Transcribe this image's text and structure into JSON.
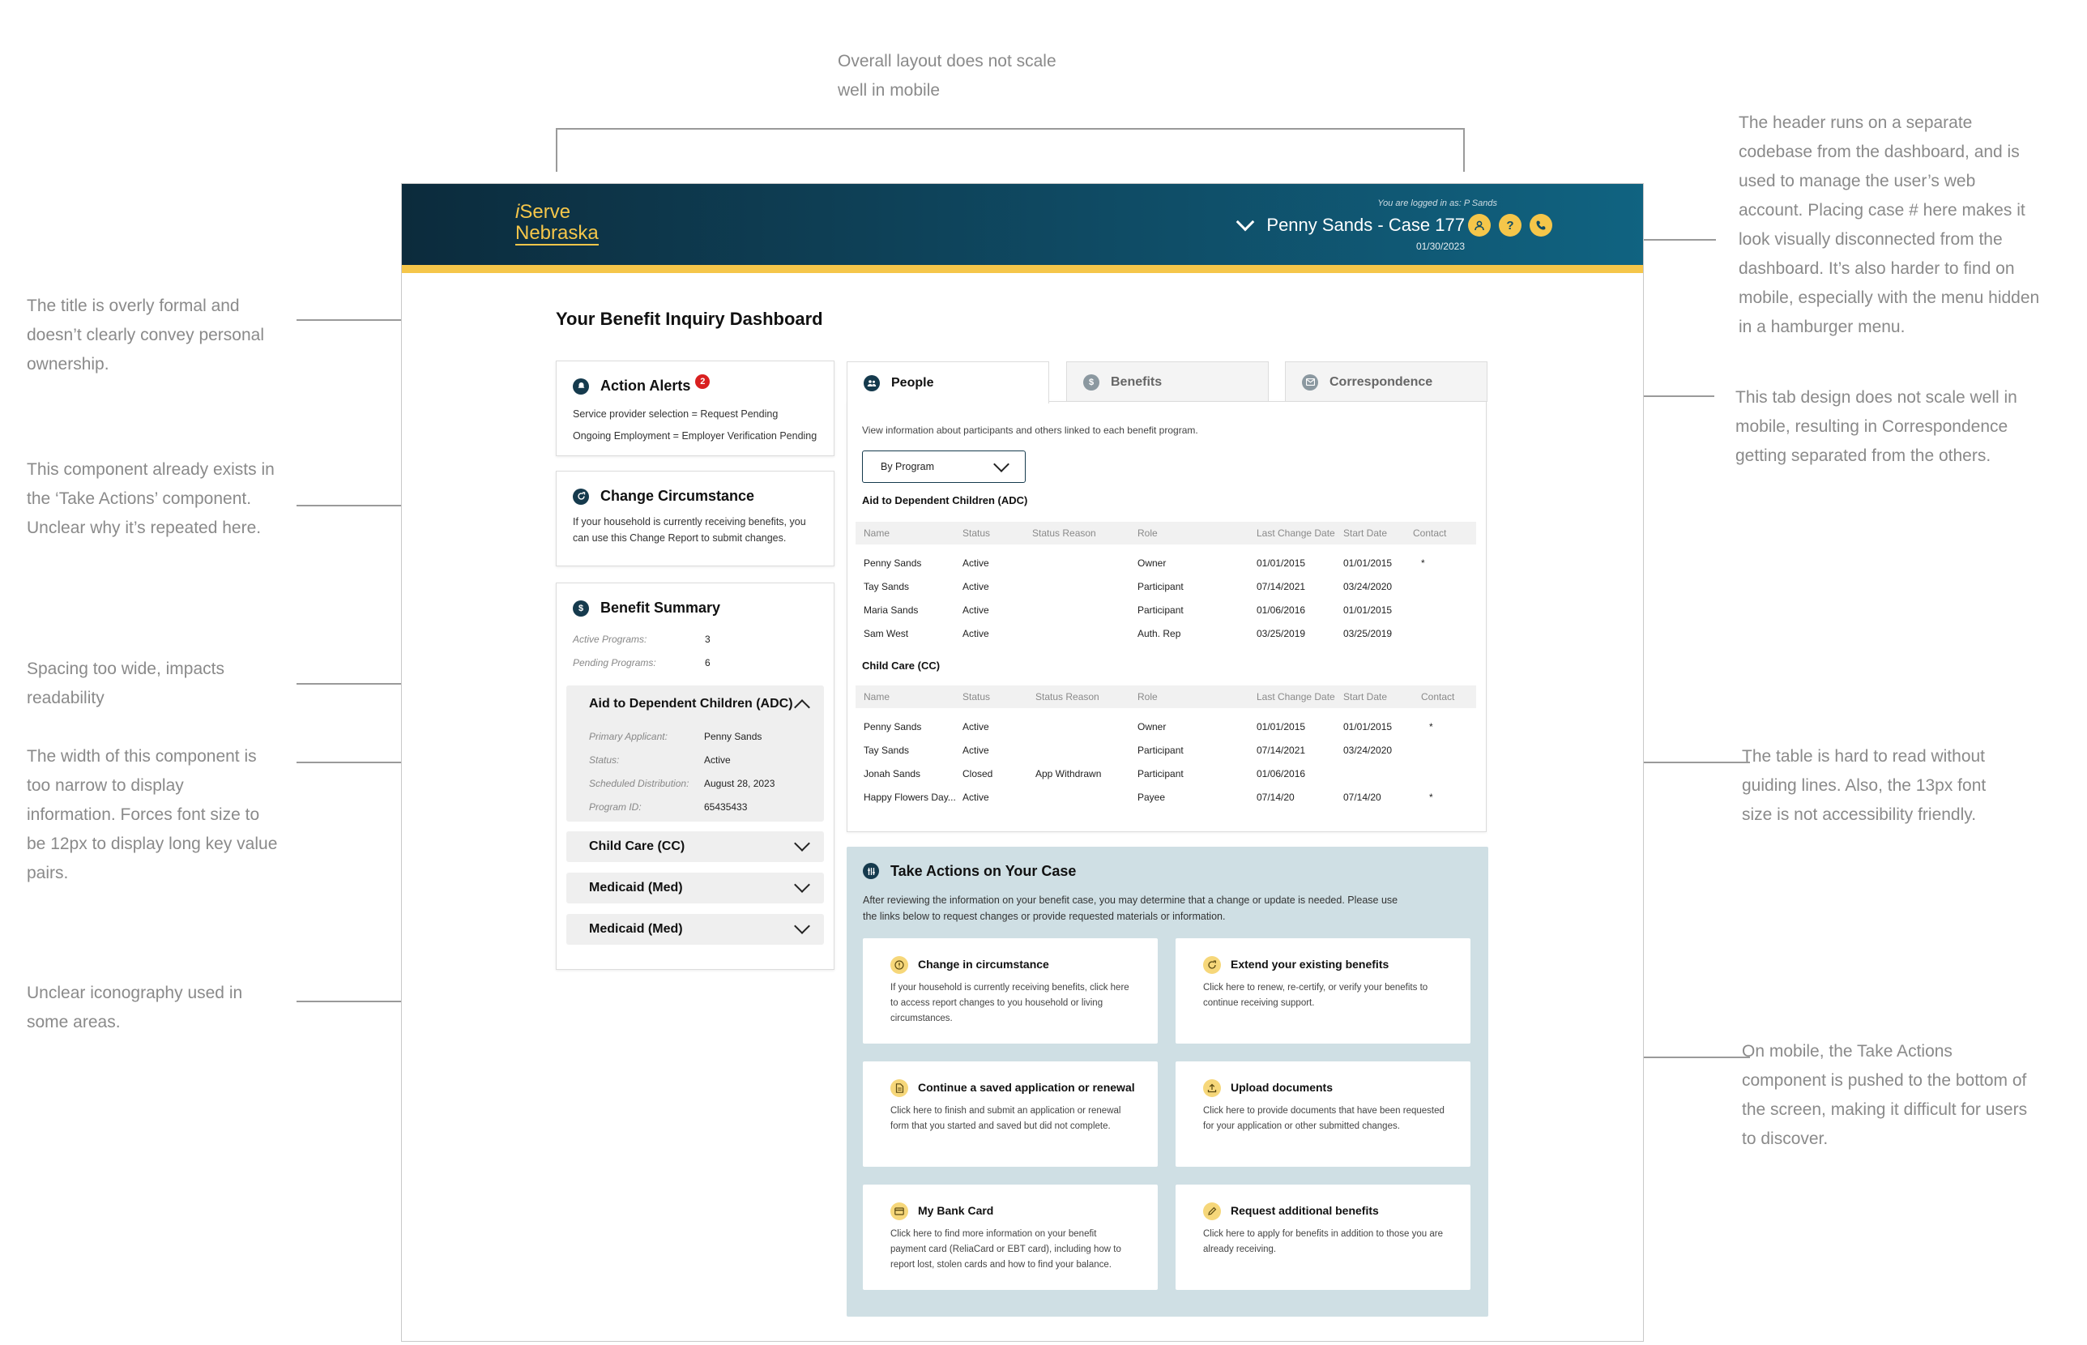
{
  "annotations": {
    "top": [
      "Overall layout does not scale",
      "well in mobile"
    ],
    "title": [
      "The title is overly formal and",
      "doesn’t clearly convey personal",
      "ownership."
    ],
    "component": [
      "This component already exists in",
      "the ‘Take Actions’ component.",
      "Unclear why it’s repeated here."
    ],
    "spacing": [
      "Spacing too wide, impacts",
      "readability"
    ],
    "width": [
      "The width of this component is",
      "too narrow to display",
      "information. Forces font size to",
      "be 12px to display long key value",
      "pairs."
    ],
    "icons": [
      "Unclear iconography used in",
      "some areas."
    ],
    "header": [
      "The header runs on a separate",
      "codebase from the dashboard, and is",
      "used to manage the user’s web",
      "account. Placing case # here makes it",
      "look visually disconnected from the",
      "dashboard.  It’s also harder to find on",
      "mobile, especially with the menu hidden",
      "in a hamburger menu."
    ],
    "tabs": [
      "This tab design does not scale well in",
      "mobile, resulting in Correspondence",
      "getting separated from the others."
    ],
    "table": [
      "The table is hard to read without",
      "guiding lines. Also, the 13px font",
      "size is not accessibility friendly."
    ],
    "mobile": [
      "On mobile, the Take Actions",
      "component is pushed to the bottom of",
      "the screen, making it difficult for users",
      "to discover."
    ]
  },
  "header": {
    "logo_i": "i",
    "logo_serve": "Serve",
    "logo_nebraska": "Nebraska",
    "logged_in": "You are logged in as: P Sands",
    "case": "Penny Sands - Case 177",
    "date": "01/30/2023",
    "icons": [
      "person-icon",
      "help-icon",
      "phone-icon"
    ],
    "accent": "#f5c64a"
  },
  "page_title": "Your Benefit Inquiry Dashboard",
  "action_alerts": {
    "title": "Action Alerts",
    "count": "2",
    "items": [
      "Service provider selection = Request Pending",
      "Ongoing Employment = Employer Verification Pending"
    ]
  },
  "change_circumstance": {
    "title": "Change Circumstance",
    "desc_1": "If your household is currently receiving benefits, you",
    "desc_2": "can use this Change Report to submit changes."
  },
  "benefit_summary": {
    "title": "Benefit Summary",
    "active_label": "Active Programs:",
    "active_value": "3",
    "pending_label": "Pending Programs:",
    "pending_value": "6",
    "expanded": {
      "title": "Aid to Dependent Children (ADC)",
      "rows": [
        {
          "k": "Primary Applicant:",
          "v": "Penny Sands"
        },
        {
          "k": "Status:",
          "v": "Active"
        },
        {
          "k": "Scheduled Distribution:",
          "v": "August 28, 2023"
        },
        {
          "k": "Program ID:",
          "v": "65435433"
        }
      ]
    },
    "collapsed": [
      "Child Care (CC)",
      "Medicaid (Med)",
      "Medicaid (Med)"
    ]
  },
  "tabs": {
    "people": "People",
    "benefits": "Benefits",
    "correspondence": "Correspondence"
  },
  "people": {
    "intro": "View information about participants and others linked to each benefit program.",
    "select": "By Program",
    "adc_title": "Aid to Dependent Children (ADC)",
    "cc_title": "Child Care (CC)",
    "columns": [
      "Name",
      "Status",
      "Status Reason",
      "Role",
      "Last Change Date",
      "Start Date",
      "Contact"
    ],
    "adc_rows": [
      [
        "Penny Sands",
        "Active",
        "",
        "Owner",
        "01/01/2015",
        "01/01/2015",
        "*"
      ],
      [
        "Tay Sands",
        "Active",
        "",
        "Participant",
        "07/14/2021",
        "03/24/2020",
        ""
      ],
      [
        "Maria Sands",
        "Active",
        "",
        "Participant",
        "01/06/2016",
        "01/01/2015",
        ""
      ],
      [
        "Sam West",
        "Active",
        "",
        "Auth. Rep",
        "03/25/2019",
        "03/25/2019",
        ""
      ]
    ],
    "cc_rows": [
      [
        "Penny Sands",
        "Active",
        "",
        "Owner",
        "01/01/2015",
        "01/01/2015",
        "*"
      ],
      [
        "Tay Sands",
        "Active",
        "",
        "Participant",
        "07/14/2021",
        "03/24/2020",
        ""
      ],
      [
        "Jonah Sands",
        "Closed",
        "App Withdrawn",
        "Participant",
        "01/06/2016",
        "",
        ""
      ],
      [
        "Happy Flowers Day...",
        "Active",
        "",
        "Payee",
        "07/14/20",
        "07/14/20",
        "*"
      ]
    ]
  },
  "take_actions": {
    "title": "Take Actions on Your Case",
    "intro_1": "After reviewing the information on your benefit case, you may determine that a change or update is needed. Please use",
    "intro_2": "the links below to request changes or provide requested materials or information.",
    "cards": [
      {
        "title": "Change in circumstance",
        "desc": "If your household is currently receiving benefits, click here to access report changes to you household or living circumstances.",
        "icon": "info-icon"
      },
      {
        "title": "Extend your existing benefits",
        "desc": "Click here to renew, re-certify, or verify your benefits to continue receiving support.",
        "icon": "refresh-icon"
      },
      {
        "title": "Continue a saved application or renewal",
        "desc": "Click here to finish and submit an application or renewal form that you started and saved but did not complete.",
        "icon": "document-icon"
      },
      {
        "title": "Upload documents",
        "desc": "Click here to provide documents that have been requested for your application or other submitted changes.",
        "icon": "upload-icon"
      },
      {
        "title": "My Bank Card",
        "desc": "Click here to find more information on your benefit payment card (ReliaCard or EBT card), including how to report lost, stolen cards and how to find your balance.",
        "icon": "card-icon"
      },
      {
        "title": "Request additional benefits",
        "desc": "Click here to apply for benefits in addition to those you are already receiving.",
        "icon": "pencil-icon"
      }
    ]
  }
}
